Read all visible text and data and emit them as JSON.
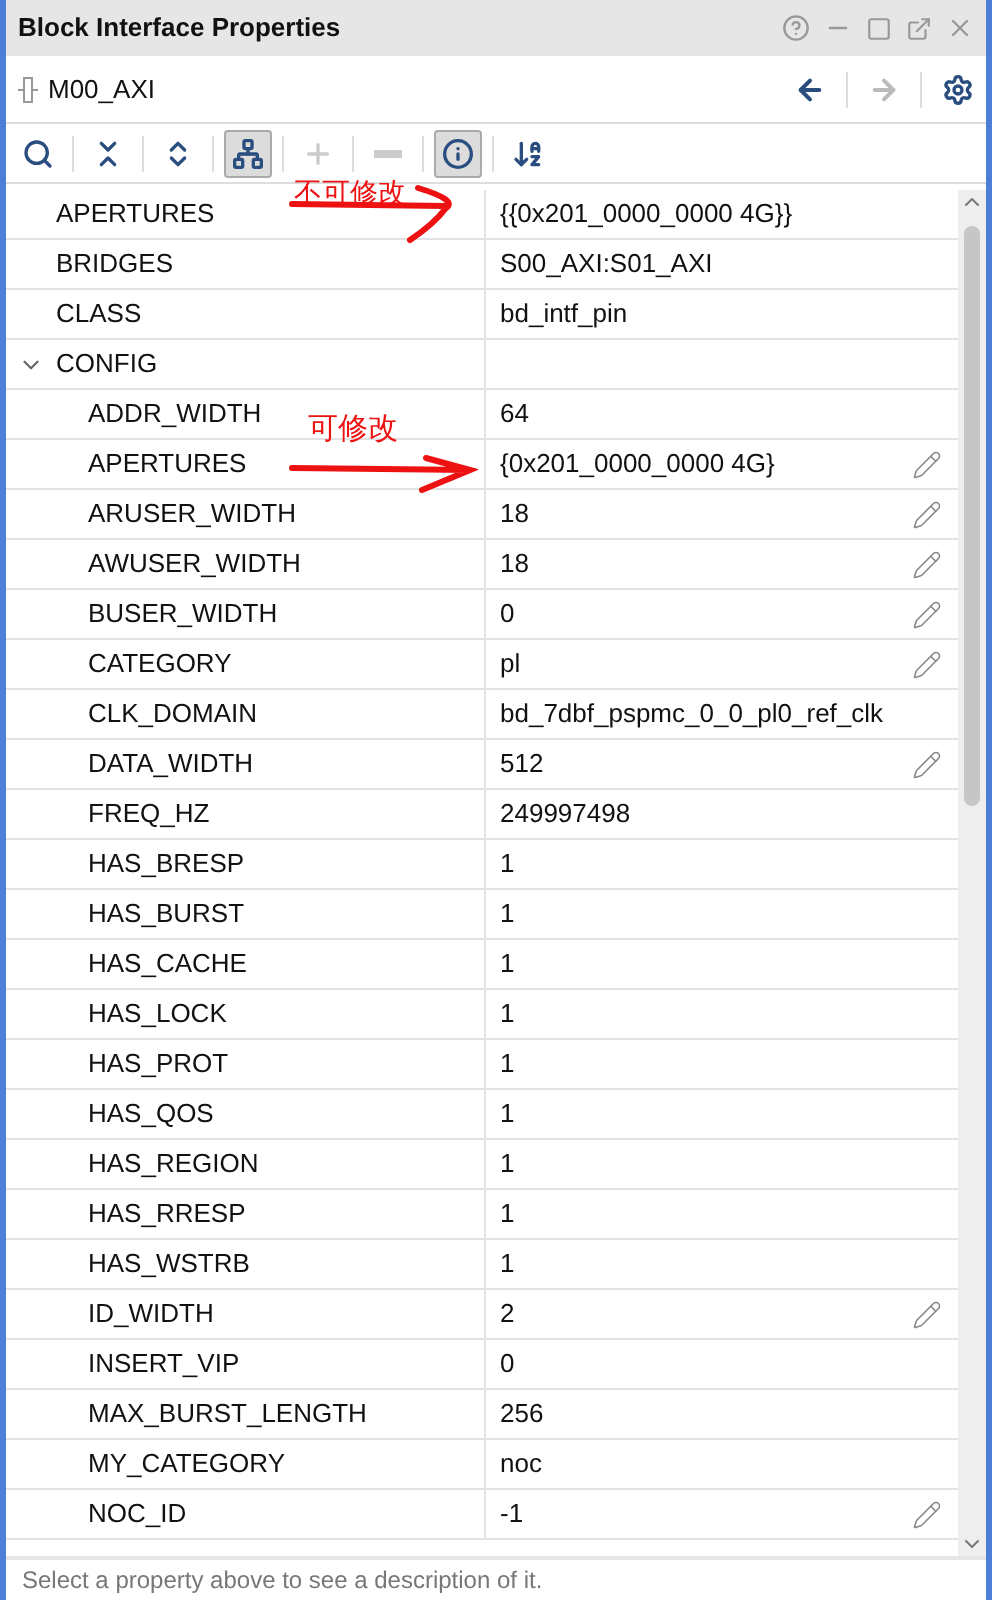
{
  "window": {
    "title": "Block Interface Properties"
  },
  "header": {
    "object": "M00_AXI",
    "back_disabled": false,
    "forward_disabled": true
  },
  "toolbar": [
    {
      "kind": "search",
      "selected": false,
      "disabled": false
    },
    {
      "kind": "collapse",
      "selected": false,
      "disabled": false
    },
    {
      "kind": "expand",
      "selected": false,
      "disabled": false
    },
    {
      "kind": "tree",
      "selected": true,
      "disabled": false
    },
    {
      "kind": "add",
      "selected": false,
      "disabled": true
    },
    {
      "kind": "remove",
      "selected": false,
      "disabled": true
    },
    {
      "kind": "info",
      "selected": true,
      "disabled": false
    },
    {
      "kind": "sort",
      "selected": false,
      "disabled": false
    }
  ],
  "properties": [
    {
      "name": "APERTURES",
      "value": "{{0x201_0000_0000 4G}}",
      "editable": false
    },
    {
      "name": "BRIDGES",
      "value": "S00_AXI:S01_AXI",
      "editable": false
    },
    {
      "name": "CLASS",
      "value": "bd_intf_pin",
      "editable": false
    },
    {
      "name": "CONFIG",
      "expanded": true,
      "children": [
        {
          "name": "ADDR_WIDTH",
          "value": "64",
          "editable": false
        },
        {
          "name": "APERTURES",
          "value": "{0x201_0000_0000 4G}",
          "editable": true
        },
        {
          "name": "ARUSER_WIDTH",
          "value": "18",
          "editable": true
        },
        {
          "name": "AWUSER_WIDTH",
          "value": "18",
          "editable": true
        },
        {
          "name": "BUSER_WIDTH",
          "value": "0",
          "editable": true
        },
        {
          "name": "CATEGORY",
          "value": "pl",
          "editable": true
        },
        {
          "name": "CLK_DOMAIN",
          "value": "bd_7dbf_pspmc_0_0_pl0_ref_clk",
          "editable": false
        },
        {
          "name": "DATA_WIDTH",
          "value": "512",
          "editable": true
        },
        {
          "name": "FREQ_HZ",
          "value": "249997498",
          "editable": false
        },
        {
          "name": "HAS_BRESP",
          "value": "1",
          "editable": false
        },
        {
          "name": "HAS_BURST",
          "value": "1",
          "editable": false
        },
        {
          "name": "HAS_CACHE",
          "value": "1",
          "editable": false
        },
        {
          "name": "HAS_LOCK",
          "value": "1",
          "editable": false
        },
        {
          "name": "HAS_PROT",
          "value": "1",
          "editable": false
        },
        {
          "name": "HAS_QOS",
          "value": "1",
          "editable": false
        },
        {
          "name": "HAS_REGION",
          "value": "1",
          "editable": false
        },
        {
          "name": "HAS_RRESP",
          "value": "1",
          "editable": false
        },
        {
          "name": "HAS_WSTRB",
          "value": "1",
          "editable": false
        },
        {
          "name": "ID_WIDTH",
          "value": "2",
          "editable": true
        },
        {
          "name": "INSERT_VIP",
          "value": "0",
          "editable": false
        },
        {
          "name": "MAX_BURST_LENGTH",
          "value": "256",
          "editable": false
        },
        {
          "name": "MY_CATEGORY",
          "value": "noc",
          "editable": false
        },
        {
          "name": "NOC_ID",
          "value": "-1",
          "editable": true
        }
      ]
    }
  ],
  "annotations": [
    {
      "text": "不可修改"
    },
    {
      "text": "可修改"
    }
  ],
  "status_bar": "Select a property above to see a description of it."
}
